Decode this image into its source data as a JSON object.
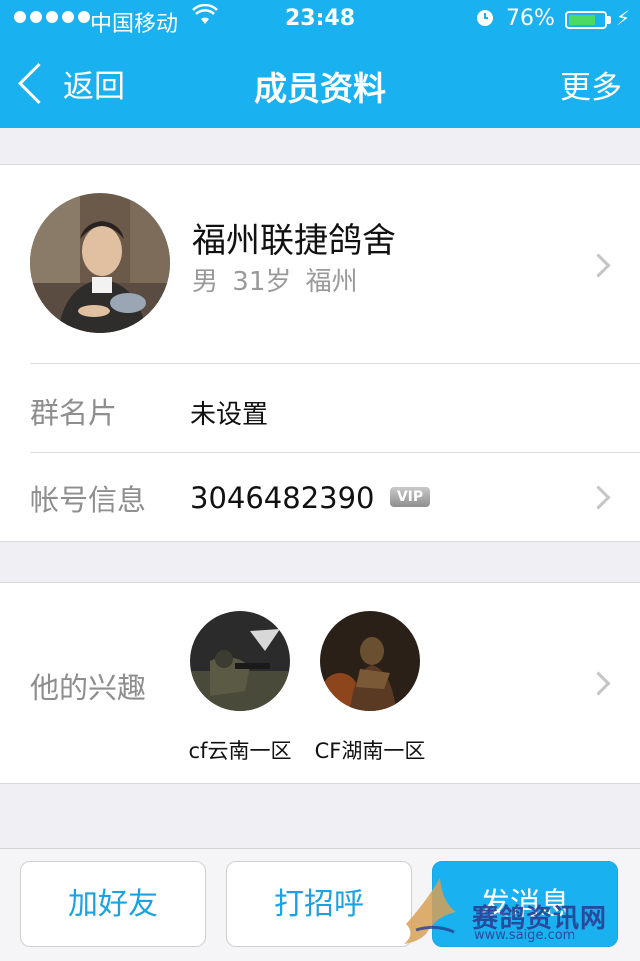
{
  "status_bar": {
    "carrier": "中国移动",
    "time": "23:48",
    "battery": "76%",
    "battery_level": 0.76
  },
  "nav": {
    "back_label": "返回",
    "title": "成员资料",
    "more_label": "更多"
  },
  "profile": {
    "name": "福州联捷鸽舍",
    "gender": "男",
    "age": "31岁",
    "city": "福州"
  },
  "rows": {
    "group_card_label": "群名片",
    "group_card_value": "未设置",
    "account_label": "帐号信息",
    "account_value": "3046482390",
    "vip_badge": "VIP"
  },
  "interests": {
    "label": "他的兴趣",
    "items": [
      {
        "name": "cf云南一区"
      },
      {
        "name": "CF湖南一区"
      }
    ]
  },
  "actions": {
    "add_friend": "加好友",
    "greet": "打招呼",
    "send_message": "发消息"
  },
  "watermark": {
    "text": "赛鸽资讯网",
    "url": "www.saige.com"
  },
  "colors": {
    "accent": "#1ab1f0",
    "button_text": "#1ba2e0",
    "background": "#efeff4"
  }
}
